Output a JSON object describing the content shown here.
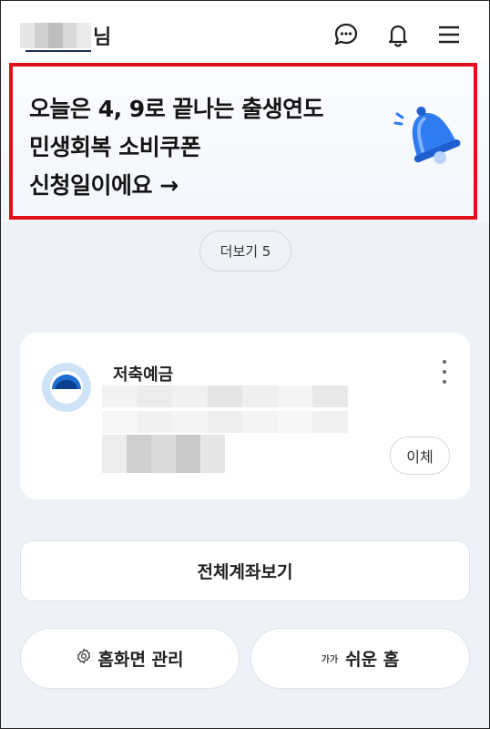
{
  "header": {
    "user_suffix": "님",
    "icons": [
      "chat-bubble-icon",
      "bell-icon",
      "hamburger-menu-icon"
    ]
  },
  "banner": {
    "lines": [
      "오늘은 4, 9로 끝나는 출생연도",
      "민생회복 소비쿠폰",
      "신청일이에요 →"
    ],
    "icon": "bell-icon"
  },
  "more": {
    "label": "더보기 5"
  },
  "account": {
    "title": "저축예금",
    "transfer_label": "이체",
    "icon": "bank-logo-icon"
  },
  "actions": {
    "all_accounts": "전체계좌보기",
    "home_manage": "홈화면 관리",
    "easy_home_prefix": "가가",
    "easy_home": "쉬운 홈"
  },
  "colors": {
    "highlight_border": "#e0101a",
    "background": "#eef2f7",
    "bell": "#2f7bf0"
  }
}
